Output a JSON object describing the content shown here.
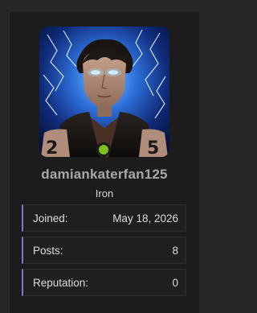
{
  "profile": {
    "username": "damiankaterfan125",
    "rank": "Iron",
    "online_status_color": "#7fbf1e",
    "avatar_icon": "user-avatar-image"
  },
  "stats": [
    {
      "label": "Joined:",
      "value": "May 18, 2026"
    },
    {
      "label": "Posts:",
      "value": "8"
    },
    {
      "label": "Reputation:",
      "value": "0"
    }
  ],
  "colors": {
    "background": "#262626",
    "panel": "#1c1c1c",
    "accent": "#7a7ad0"
  }
}
